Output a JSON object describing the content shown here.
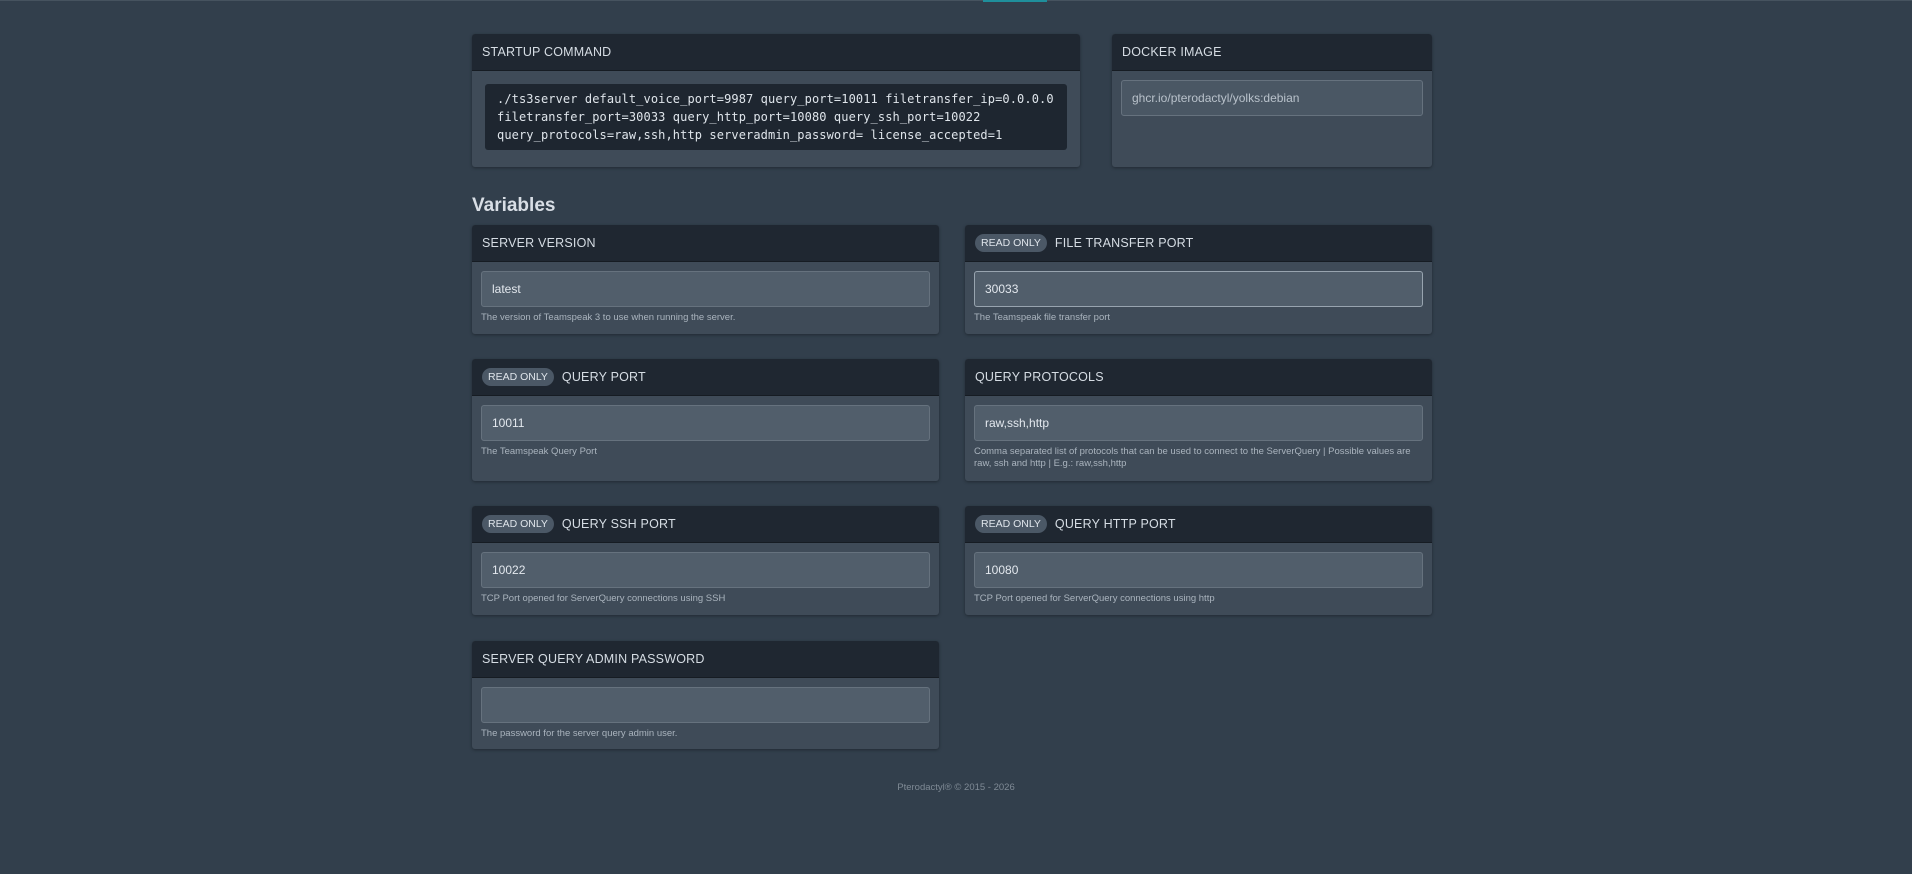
{
  "startup": {
    "title": "STARTUP COMMAND",
    "command_lines": [
      "./ts3server default_voice_port=9987 query_port=10011 filetransfer_ip=0.0.0.0",
      "filetransfer_port=30033 query_http_port=10080 query_ssh_port=10022",
      "query_protocols=raw,ssh,http serveradmin_password= license_accepted=1"
    ]
  },
  "docker": {
    "title": "DOCKER IMAGE",
    "image": "ghcr.io/pterodactyl/yolks:debian"
  },
  "variables_title": "Variables",
  "read_only_label": "READ ONLY",
  "variables": [
    {
      "name": "SERVER VERSION",
      "value": "latest",
      "description": "The version of Teamspeak 3 to use when running the server.",
      "read_only": false
    },
    {
      "name": "FILE TRANSFER PORT",
      "value": "30033",
      "description": "The Teamspeak file transfer port",
      "read_only": true
    },
    {
      "name": "QUERY PORT",
      "value": "10011",
      "description": "The Teamspeak Query Port",
      "read_only": true
    },
    {
      "name": "QUERY PROTOCOLS",
      "value": "raw,ssh,http",
      "description": "Comma separated list of protocols that can be used to connect to the ServerQuery | Possible values are raw, ssh and http | E.g.: raw,ssh,http",
      "read_only": false
    },
    {
      "name": "QUERY SSH PORT",
      "value": "10022",
      "description": "TCP Port opened for ServerQuery connections using SSH",
      "read_only": true
    },
    {
      "name": "QUERY HTTP PORT",
      "value": "10080",
      "description": "TCP Port opened for ServerQuery connections using http",
      "read_only": true
    },
    {
      "name": "SERVER QUERY ADMIN PASSWORD",
      "value": "",
      "description": "The password for the server query admin user.",
      "read_only": false
    }
  ],
  "footer": "Pterodactyl® © 2015 - 2026"
}
